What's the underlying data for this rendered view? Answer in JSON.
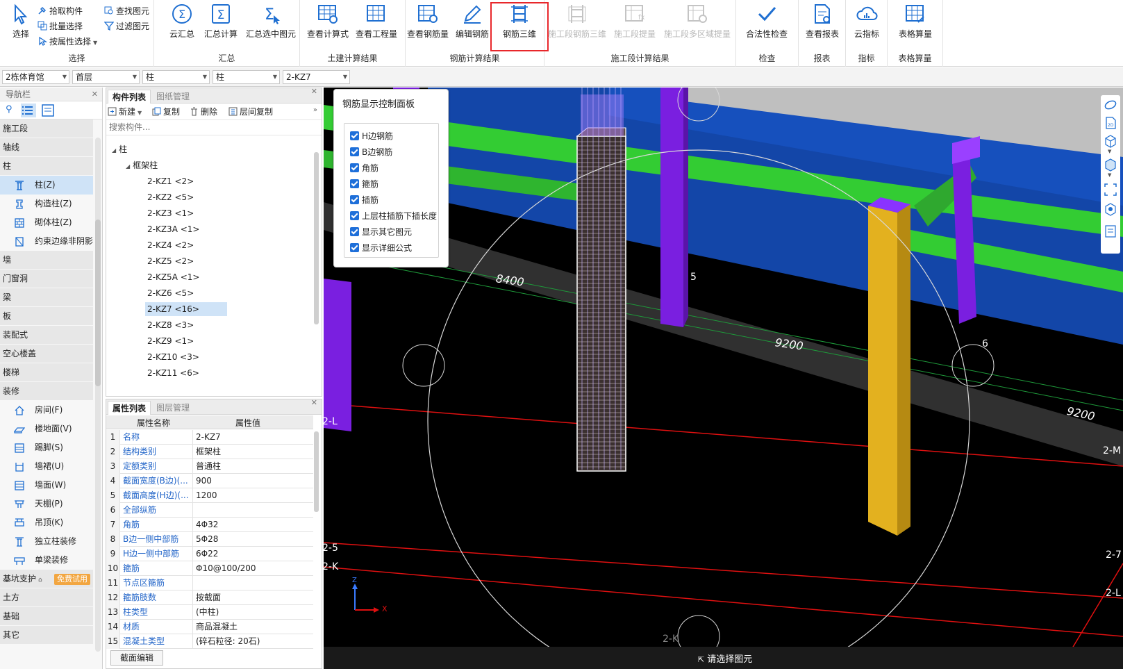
{
  "ribbon": {
    "groups": [
      {
        "label": "选择"
      },
      {
        "label": "汇总"
      },
      {
        "label": "土建计算结果"
      },
      {
        "label": "钢筋计算结果"
      },
      {
        "label": "施工段计算结果"
      },
      {
        "label": "检查"
      },
      {
        "label": "报表"
      },
      {
        "label": "指标"
      },
      {
        "label": "表格算量"
      }
    ],
    "select_big": "选择",
    "select_small": [
      "拾取构件",
      "批量选择",
      "按属性选择",
      "查找图元",
      "过滤图元"
    ],
    "summary": [
      "云汇总",
      "汇总计算",
      "汇总选中图元"
    ],
    "civil": [
      "查看计算式",
      "查看工程量"
    ],
    "rebar": [
      "查看钢筋量",
      "编辑钢筋",
      "钢筋三维"
    ],
    "stage": [
      "施工段钢筋三维",
      "施工段提量",
      "施工段多区域提量"
    ],
    "check": [
      "合法性检查"
    ],
    "report": [
      "查看报表"
    ],
    "index": [
      "云指标"
    ],
    "table": [
      "表格算量"
    ],
    "accent_color": "#1f6fd1",
    "highlight_color": "#e8272b"
  },
  "selector_bar": {
    "building": "2栋体育馆",
    "floor": "首层",
    "type": "柱",
    "subtype": "柱",
    "component": "2-KZ7"
  },
  "nav": {
    "title": "导航栏",
    "categories_top": [
      "施工段",
      "轴线",
      "柱"
    ],
    "column_items": [
      "柱(Z)",
      "构造柱(Z)",
      "砌体柱(Z)",
      "约束边缘非阴影"
    ],
    "categories_mid": [
      "墙",
      "门窗洞",
      "梁",
      "板",
      "装配式",
      "空心楼盖",
      "楼梯",
      "装修"
    ],
    "deco_items": [
      "房间(F)",
      "楼地面(V)",
      "踢脚(S)",
      "墙裙(U)",
      "墙面(W)",
      "天棚(P)",
      "吊顶(K)",
      "独立柱装修",
      "单梁装修"
    ],
    "categories_bottom": [
      "基坑支护",
      "土方",
      "基础",
      "其它"
    ],
    "trial_badge": "免费试用"
  },
  "component_panel": {
    "tabs": [
      "构件列表",
      "图纸管理"
    ],
    "tools": [
      "新建",
      "复制",
      "删除",
      "层间复制"
    ],
    "search_placeholder": "搜索构件...",
    "tree_root": "柱",
    "tree_group": "框架柱",
    "items": [
      "2-KZ1 <2>",
      "2-KZ2 <5>",
      "2-KZ3 <1>",
      "2-KZ3A <1>",
      "2-KZ4 <2>",
      "2-KZ5 <2>",
      "2-KZ5A <1>",
      "2-KZ6 <5>",
      "2-KZ7 <16>",
      "2-KZ8 <3>",
      "2-KZ9 <1>",
      "2-KZ10 <3>",
      "2-KZ11 <6>"
    ],
    "selected_index": 8
  },
  "property_panel": {
    "tabs": [
      "属性列表",
      "图层管理"
    ],
    "headers": [
      "属性名称",
      "属性值"
    ],
    "rows": [
      {
        "n": "1",
        "name": "名称",
        "value": "2-KZ7"
      },
      {
        "n": "2",
        "name": "结构类别",
        "value": "框架柱"
      },
      {
        "n": "3",
        "name": "定额类别",
        "value": "普通柱"
      },
      {
        "n": "4",
        "name": "截面宽度(B边)(...",
        "value": "900"
      },
      {
        "n": "5",
        "name": "截面高度(H边)(...",
        "value": "1200"
      },
      {
        "n": "6",
        "name": "全部纵筋",
        "value": ""
      },
      {
        "n": "7",
        "name": "角筋",
        "value": "4Φ32"
      },
      {
        "n": "8",
        "name": "B边一侧中部筋",
        "value": "5Φ28"
      },
      {
        "n": "9",
        "name": "H边一侧中部筋",
        "value": "6Φ22"
      },
      {
        "n": "10",
        "name": "箍筋",
        "value": "Φ10@100/200"
      },
      {
        "n": "11",
        "name": "节点区箍筋",
        "value": ""
      },
      {
        "n": "12",
        "name": "箍筋肢数",
        "value": "按截面"
      },
      {
        "n": "13",
        "name": "柱类型",
        "value": "(中柱)"
      },
      {
        "n": "14",
        "name": "材质",
        "value": "商品混凝土"
      },
      {
        "n": "15",
        "name": "混凝土类型",
        "value": "(碎石粒径: 20石)"
      }
    ],
    "section_edit": "截面编辑"
  },
  "rebar_panel": {
    "title": "钢筋显示控制面板",
    "options": [
      "H边钢筋",
      "B边钢筋",
      "角筋",
      "箍筋",
      "插筋",
      "上层柱插筋下插长度",
      "显示其它图元",
      "显示详细公式"
    ]
  },
  "viewport": {
    "dims": [
      "8400",
      "9200",
      "9200"
    ],
    "axis_labels": [
      "5",
      "6",
      "2-L",
      "2-M",
      "2-5",
      "2-K",
      "2-7",
      "2-L",
      "2-K"
    ],
    "gizmo": {
      "z": "Z",
      "x": "X"
    },
    "status_hint": "请选择图元",
    "colors": {
      "column_purple": "#7a1fe0",
      "column_yellow": "#e3b11f",
      "beam_green": "#33cc33",
      "wall_blue": "#1346a8",
      "grid_red": "#e01010",
      "grid_green": "#1e9a3a"
    }
  }
}
